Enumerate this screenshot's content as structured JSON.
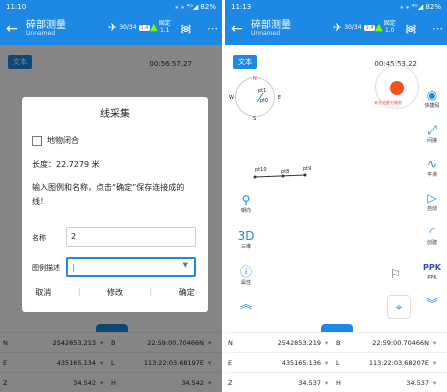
{
  "left": {
    "status": {
      "time": "11:10",
      "right": "⁎ ⁎ ⁴ᴳ◢ 82%"
    },
    "appbar": {
      "title": "碎部测量",
      "subtitle": "Unnamed",
      "sat": "30/34",
      "sat_chip": "1.4",
      "fix": "固定",
      "fix2": "1.1"
    },
    "text_btn": "文本",
    "time": "00:56:57.27",
    "dialog": {
      "title": "线采集",
      "checkbox": "地物闭合",
      "length": "长度：22.7279 米",
      "prompt": "输入图例和名称，点击“确定”保存连接成的线！",
      "name_label": "名称",
      "name_value": "2",
      "legend_label": "图例描述",
      "legend_caret": "▼",
      "cancel": "取消",
      "modify": "修改",
      "ok": "确定"
    },
    "coords": [
      {
        "k": "N",
        "v": "2542853.213",
        "k2": "B",
        "v2": "22:59:00.70466N"
      },
      {
        "k": "E",
        "v": "435165.134",
        "k2": "L",
        "v2": "113:22:03.68197E"
      },
      {
        "k": "Z",
        "v": "34.542",
        "k2": "H",
        "v2": "34.542"
      }
    ]
  },
  "right": {
    "status": {
      "time": "11:13",
      "right": "⁎ ⁎ ⁴ᴳ◢ 82%"
    },
    "appbar": {
      "title": "碎部测量",
      "subtitle": "Unnamed",
      "sat": "30/34",
      "sat_chip": "1.4",
      "fix": "固定",
      "fix2": "1.0"
    },
    "text_btn": "文本",
    "time": "00:45:53.22",
    "compass": {
      "n": "N",
      "e": "E",
      "s": "S",
      "w": "W",
      "pt": "pt1",
      "pt2": "pt0"
    },
    "line_labels": [
      "pt10",
      "pt8",
      "pt9"
    ],
    "big_hint": "未开启差分服务",
    "right_tools": [
      {
        "g": "◉",
        "l": "快捷码"
      },
      {
        "g": "⤢",
        "l": "间接"
      },
      {
        "g": "∿",
        "l": "平滑"
      },
      {
        "g": "▷",
        "l": "自动"
      },
      {
        "g": "◜",
        "l": "创建"
      },
      {
        "g": "PPK",
        "l": "PPK"
      }
    ],
    "left_tools": [
      {
        "g": "⚲",
        "l": "朝向"
      },
      {
        "g": "3D",
        "l": "三维"
      },
      {
        "g": "ⓘ",
        "l": "属性"
      },
      {
        "g": "︽",
        "l": ""
      }
    ],
    "coords": [
      {
        "k": "N",
        "v": "2542853.219",
        "k2": "B",
        "v2": "22:59:00.70466N"
      },
      {
        "k": "E",
        "v": "435165.136",
        "k2": "L",
        "v2": "113:22:03.68207E"
      },
      {
        "k": "Z",
        "v": "34.537",
        "k2": "H",
        "v2": "34.537"
      }
    ]
  }
}
